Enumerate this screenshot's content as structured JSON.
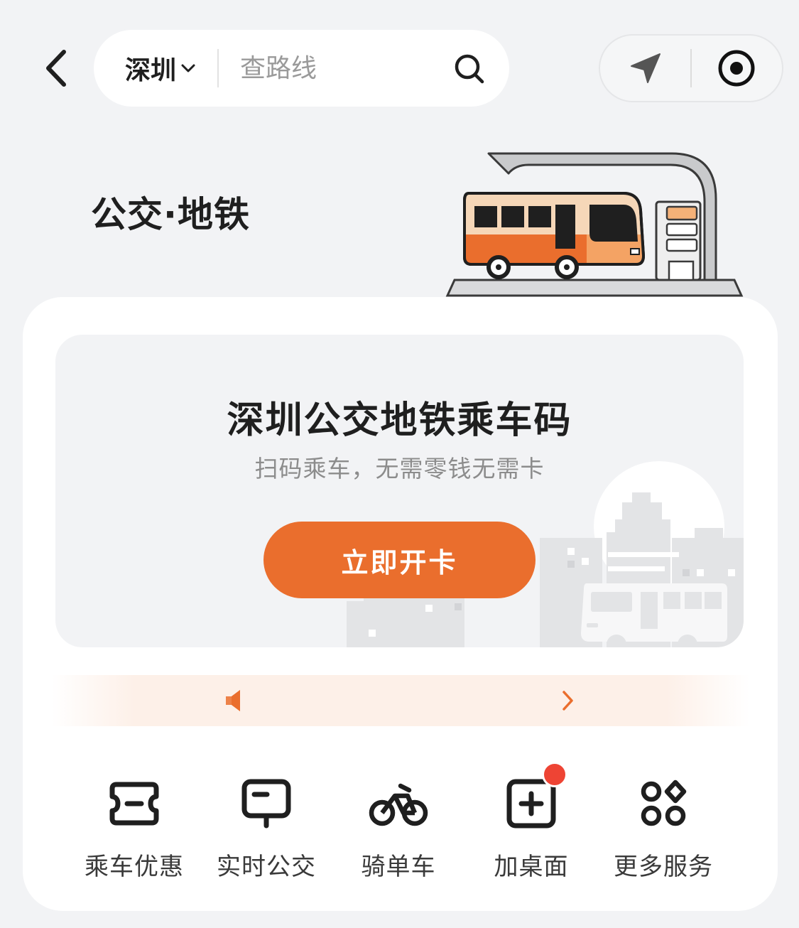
{
  "header": {
    "back_icon": "chevron-left-icon",
    "city": "深圳",
    "city_icon": "chevron-down-icon",
    "search_placeholder": "查路线",
    "search_icon": "search-icon",
    "capsule": {
      "location_icon": "navigation-arrow-icon",
      "target_icon": "record-target-icon"
    }
  },
  "page_title": "公交·地铁",
  "promo": {
    "title": "深圳公交地铁乘车码",
    "subtitle": "扫码乘车，无需零钱无需卡",
    "button_label": "立即开卡"
  },
  "notice": {
    "icon": "speaker-icon",
    "text": "",
    "arrow_icon": "chevron-right-icon"
  },
  "services": [
    {
      "label": "乘车优惠",
      "icon": "ticket-icon"
    },
    {
      "label": "实时公交",
      "icon": "bus-sign-icon"
    },
    {
      "label": "骑单车",
      "icon": "bicycle-icon"
    },
    {
      "label": "加桌面",
      "icon": "add-to-desktop-icon",
      "badge": "red-dot"
    },
    {
      "label": "更多服务",
      "icon": "more-services-icon"
    }
  ],
  "colors": {
    "accent": "#ea6e2d",
    "background": "#f2f3f5",
    "badge": "#ee4434",
    "text": "#1f1f1f"
  }
}
